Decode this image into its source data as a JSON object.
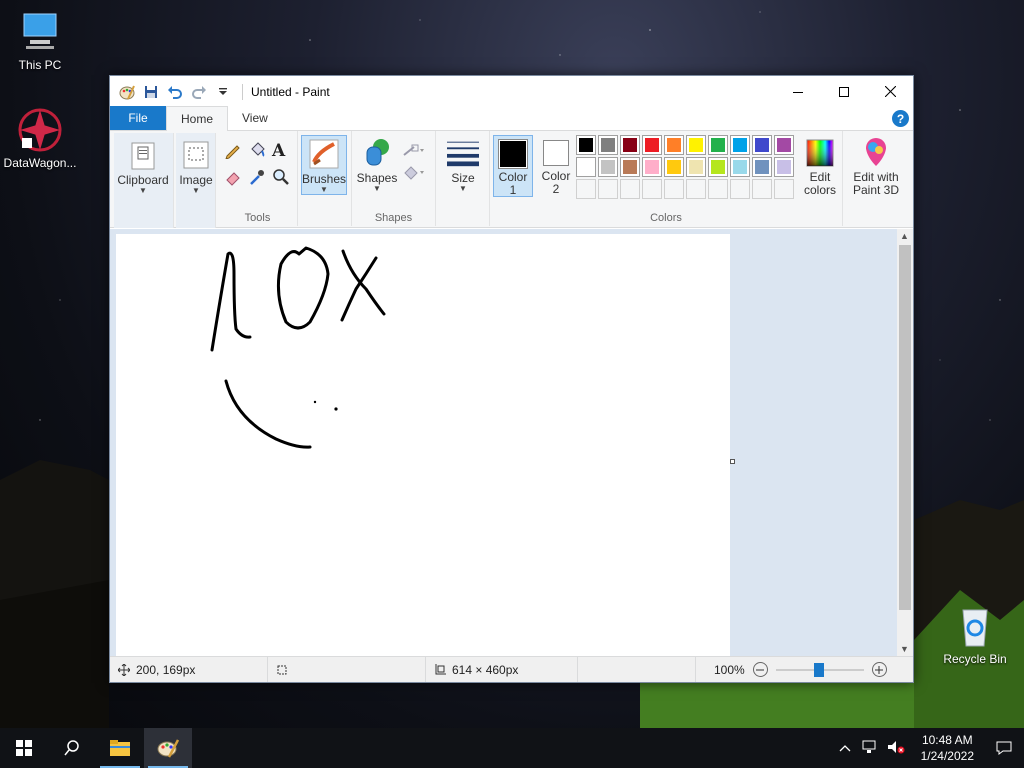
{
  "desktop": {
    "icons": [
      {
        "label": "This PC"
      },
      {
        "label": "DataWagon..."
      },
      {
        "label": "Recycle Bin"
      }
    ]
  },
  "window": {
    "title": "Untitled - Paint",
    "tabs": [
      {
        "label": "File"
      },
      {
        "label": "Home"
      },
      {
        "label": "View"
      }
    ],
    "help_label": "?"
  },
  "ribbon": {
    "clipboard_label": "Clipboard",
    "image_label": "Image",
    "tools_group_label": "Tools",
    "brushes_label": "Brushes",
    "shapes_label": "Shapes",
    "shapes_group_label": "Shapes",
    "size_label": "Size",
    "color1_label": "Color\n1",
    "color2_label": "Color\n2",
    "colors_group_label": "Colors",
    "edit_colors_label": "Edit\ncolors",
    "edit_3d_label": "Edit with\nPaint 3D",
    "text_tool_glyph": "A",
    "color1_value": "#000000",
    "color2_value": "#ffffff",
    "palette_row1": [
      "#000000",
      "#7f7f7f",
      "#880015",
      "#ed1c24",
      "#ff7f27",
      "#fff200",
      "#22b14c",
      "#00a2e8",
      "#3f48cc",
      "#a349a4"
    ],
    "palette_row2": [
      "#ffffff",
      "#c3c3c3",
      "#b97a57",
      "#ffaec9",
      "#ffc90e",
      "#efe4b0",
      "#b5e61d",
      "#99d9ea",
      "#7092be",
      "#c8bfe7"
    ],
    "palette_row3_count": 10
  },
  "status": {
    "cursor_pos": "200, 169px",
    "canvas_size": "614 × 460px",
    "zoom": "100%"
  },
  "taskbar": {
    "time": "10:48 AM",
    "date": "1/24/2022"
  }
}
